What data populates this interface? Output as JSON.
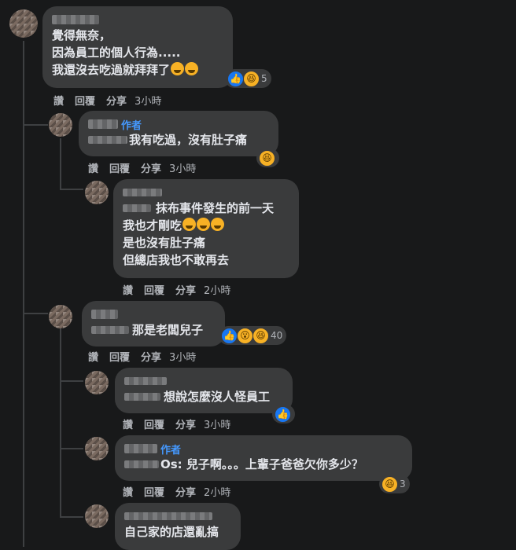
{
  "actions": {
    "like": "讚",
    "reply": "回覆",
    "share": "分享"
  },
  "comments": [
    {
      "lines": [
        "覺得無奈，",
        "因為員工的個人行為.....",
        "我還沒去吃過就拜拜了"
      ],
      "time": "3小時",
      "reactions": {
        "icons": [
          "like-icon",
          "haha-icon"
        ],
        "count": "5"
      }
    },
    {
      "badge": "作者",
      "lines": [
        "我有吃過，沒有肚子痛"
      ],
      "time": "3小時",
      "reactions": {
        "icons": [
          "haha-icon"
        ]
      }
    },
    {
      "lines": [
        "抹布事件發生的前一天",
        "我也才剛吃",
        "是也沒有肚子痛",
        "但總店我也不敢再去"
      ],
      "time": "2小時"
    },
    {
      "lines": [
        "那是老闆兒子"
      ],
      "time": "3小時",
      "reactions": {
        "icons": [
          "like-icon",
          "wow-icon",
          "haha-icon"
        ],
        "count": "40"
      }
    },
    {
      "lines": [
        "想說怎麼沒人怪員工"
      ],
      "time": "3小時",
      "reactions": {
        "icons": [
          "like-icon"
        ]
      }
    },
    {
      "badge": "作者",
      "lines": [
        "Os: 兒子啊。。。上輩子爸爸欠你多少？"
      ],
      "time": "2小時",
      "reactions": {
        "icons": [
          "haha-icon"
        ],
        "count": "3"
      }
    },
    {
      "lines": [
        "自己家的店還亂搞"
      ]
    }
  ]
}
